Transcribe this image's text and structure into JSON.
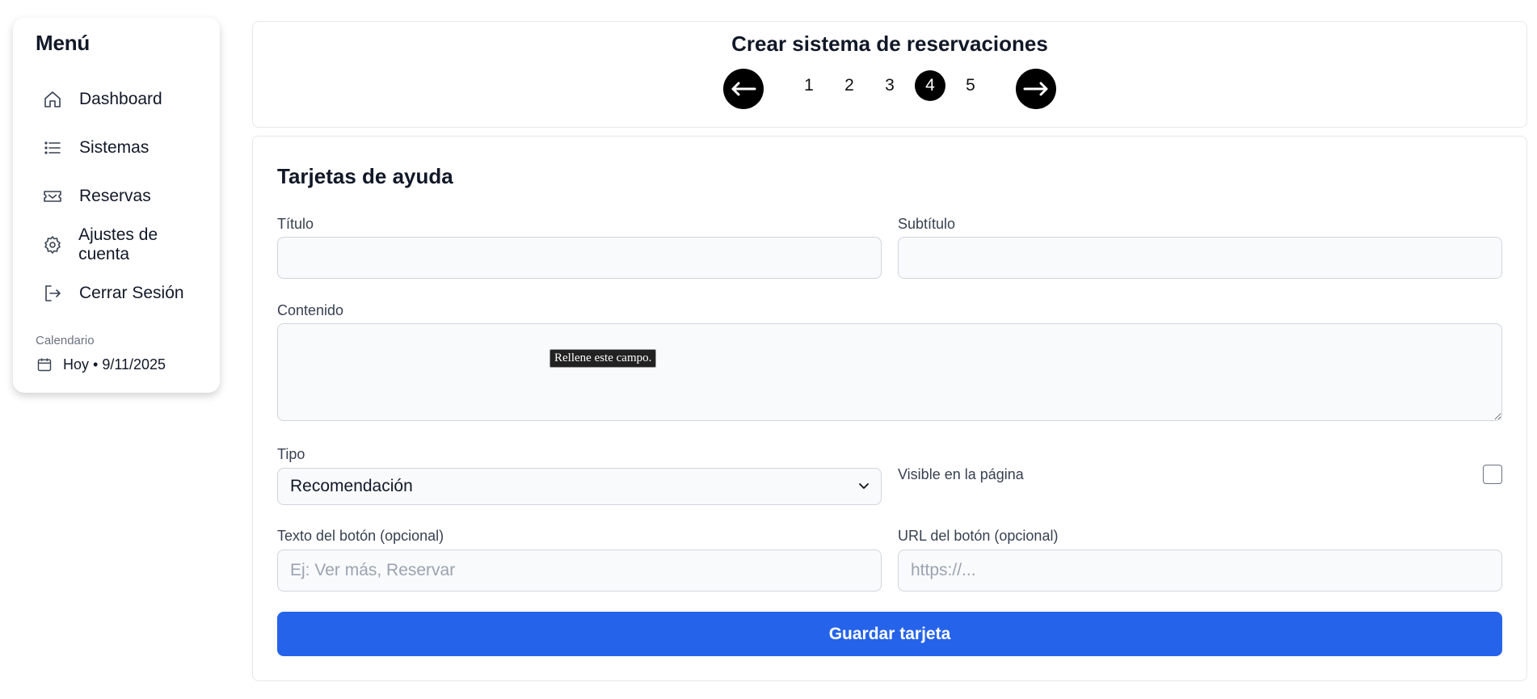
{
  "sidebar": {
    "title": "Menú",
    "items": [
      {
        "label": "Dashboard",
        "icon": "home-icon"
      },
      {
        "label": "Sistemas",
        "icon": "list-icon"
      },
      {
        "label": "Reservas",
        "icon": "ticket-icon"
      },
      {
        "label": "Ajustes de cuenta",
        "icon": "gear-icon"
      },
      {
        "label": "Cerrar Sesión",
        "icon": "logout-icon"
      }
    ],
    "calendar_label": "Calendario",
    "calendar_value": "Hoy • 9/11/2025"
  },
  "header": {
    "title": "Crear sistema de reservaciones",
    "steps": [
      "1",
      "2",
      "3",
      "4",
      "5"
    ],
    "active_step": "4"
  },
  "form": {
    "section_title": "Tarjetas de ayuda",
    "titulo_label": "Título",
    "titulo_value": "",
    "subtitulo_label": "Subtítulo",
    "subtitulo_value": "",
    "contenido_label": "Contenido",
    "contenido_value": "",
    "tipo_label": "Tipo",
    "tipo_value": "Recomendación",
    "visible_label": "Visible en la página",
    "visible_checked": false,
    "boton_texto_label": "Texto del botón (opcional)",
    "boton_texto_placeholder": "Ej: Ver más, Reservar",
    "boton_url_label": "URL del botón (opcional)",
    "boton_url_placeholder": "https://...",
    "save_label": "Guardar tarjeta"
  },
  "tooltip": "Rellene este campo.",
  "colors": {
    "primary": "#2563eb",
    "active_step": "#000000",
    "input_bg": "#f8fafc"
  }
}
